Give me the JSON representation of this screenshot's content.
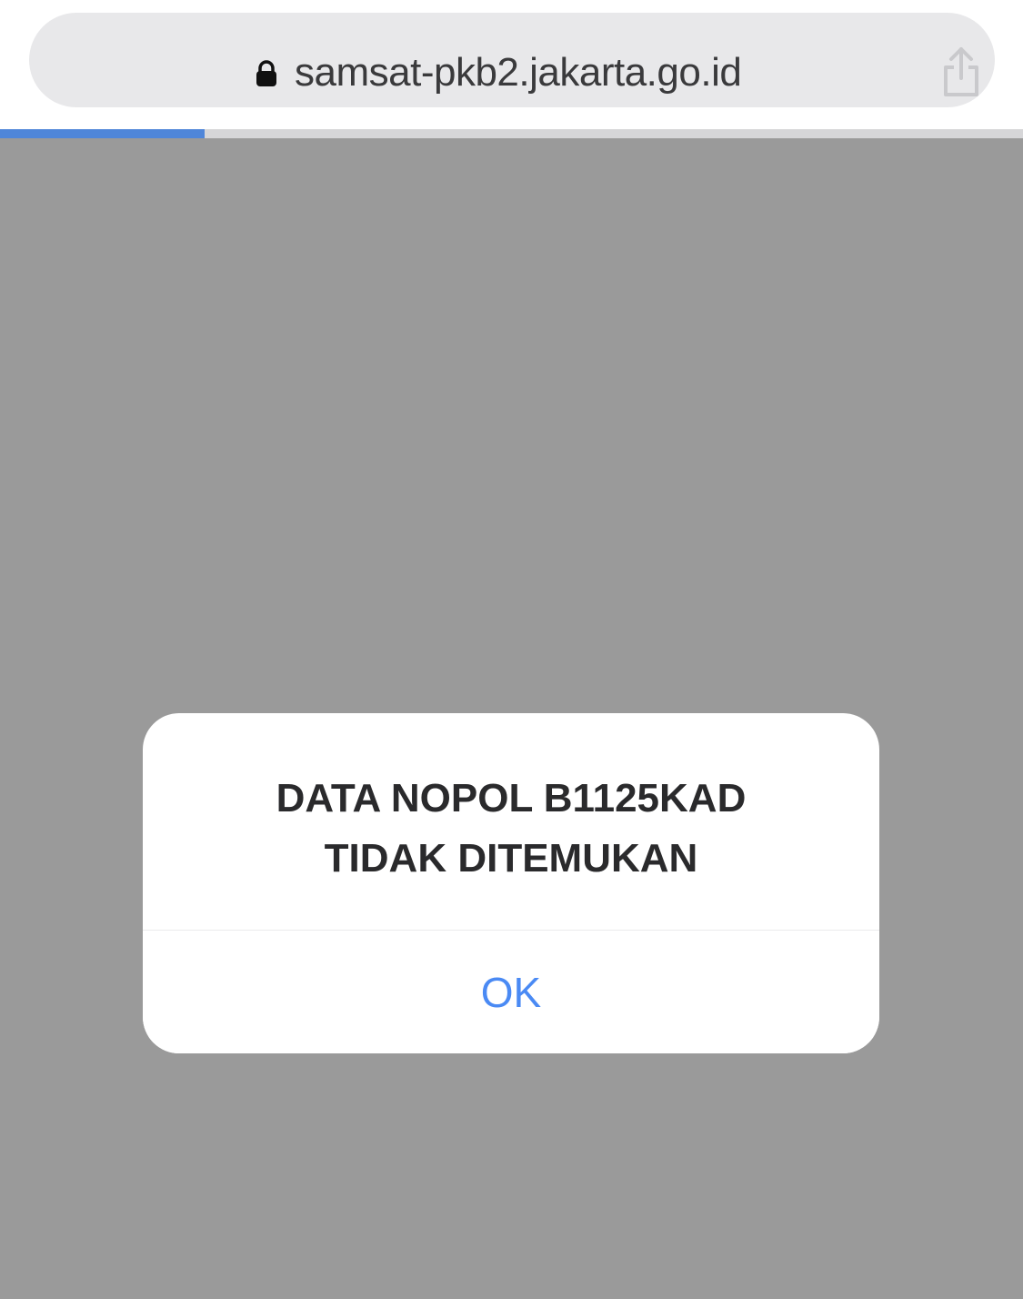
{
  "browser": {
    "url": "samsat-pkb2.jakarta.go.id",
    "lock_icon": "lock-icon",
    "share_icon": "share-icon",
    "load_progress": 0.2
  },
  "alert": {
    "message": "DATA NOPOL B1125KAD\nTIDAK DITEMUKAN",
    "ok_label": "OK"
  },
  "colors": {
    "overlay": "#9a9a9a",
    "progress": "#4f86d9",
    "ok_button": "#4a8af4"
  }
}
